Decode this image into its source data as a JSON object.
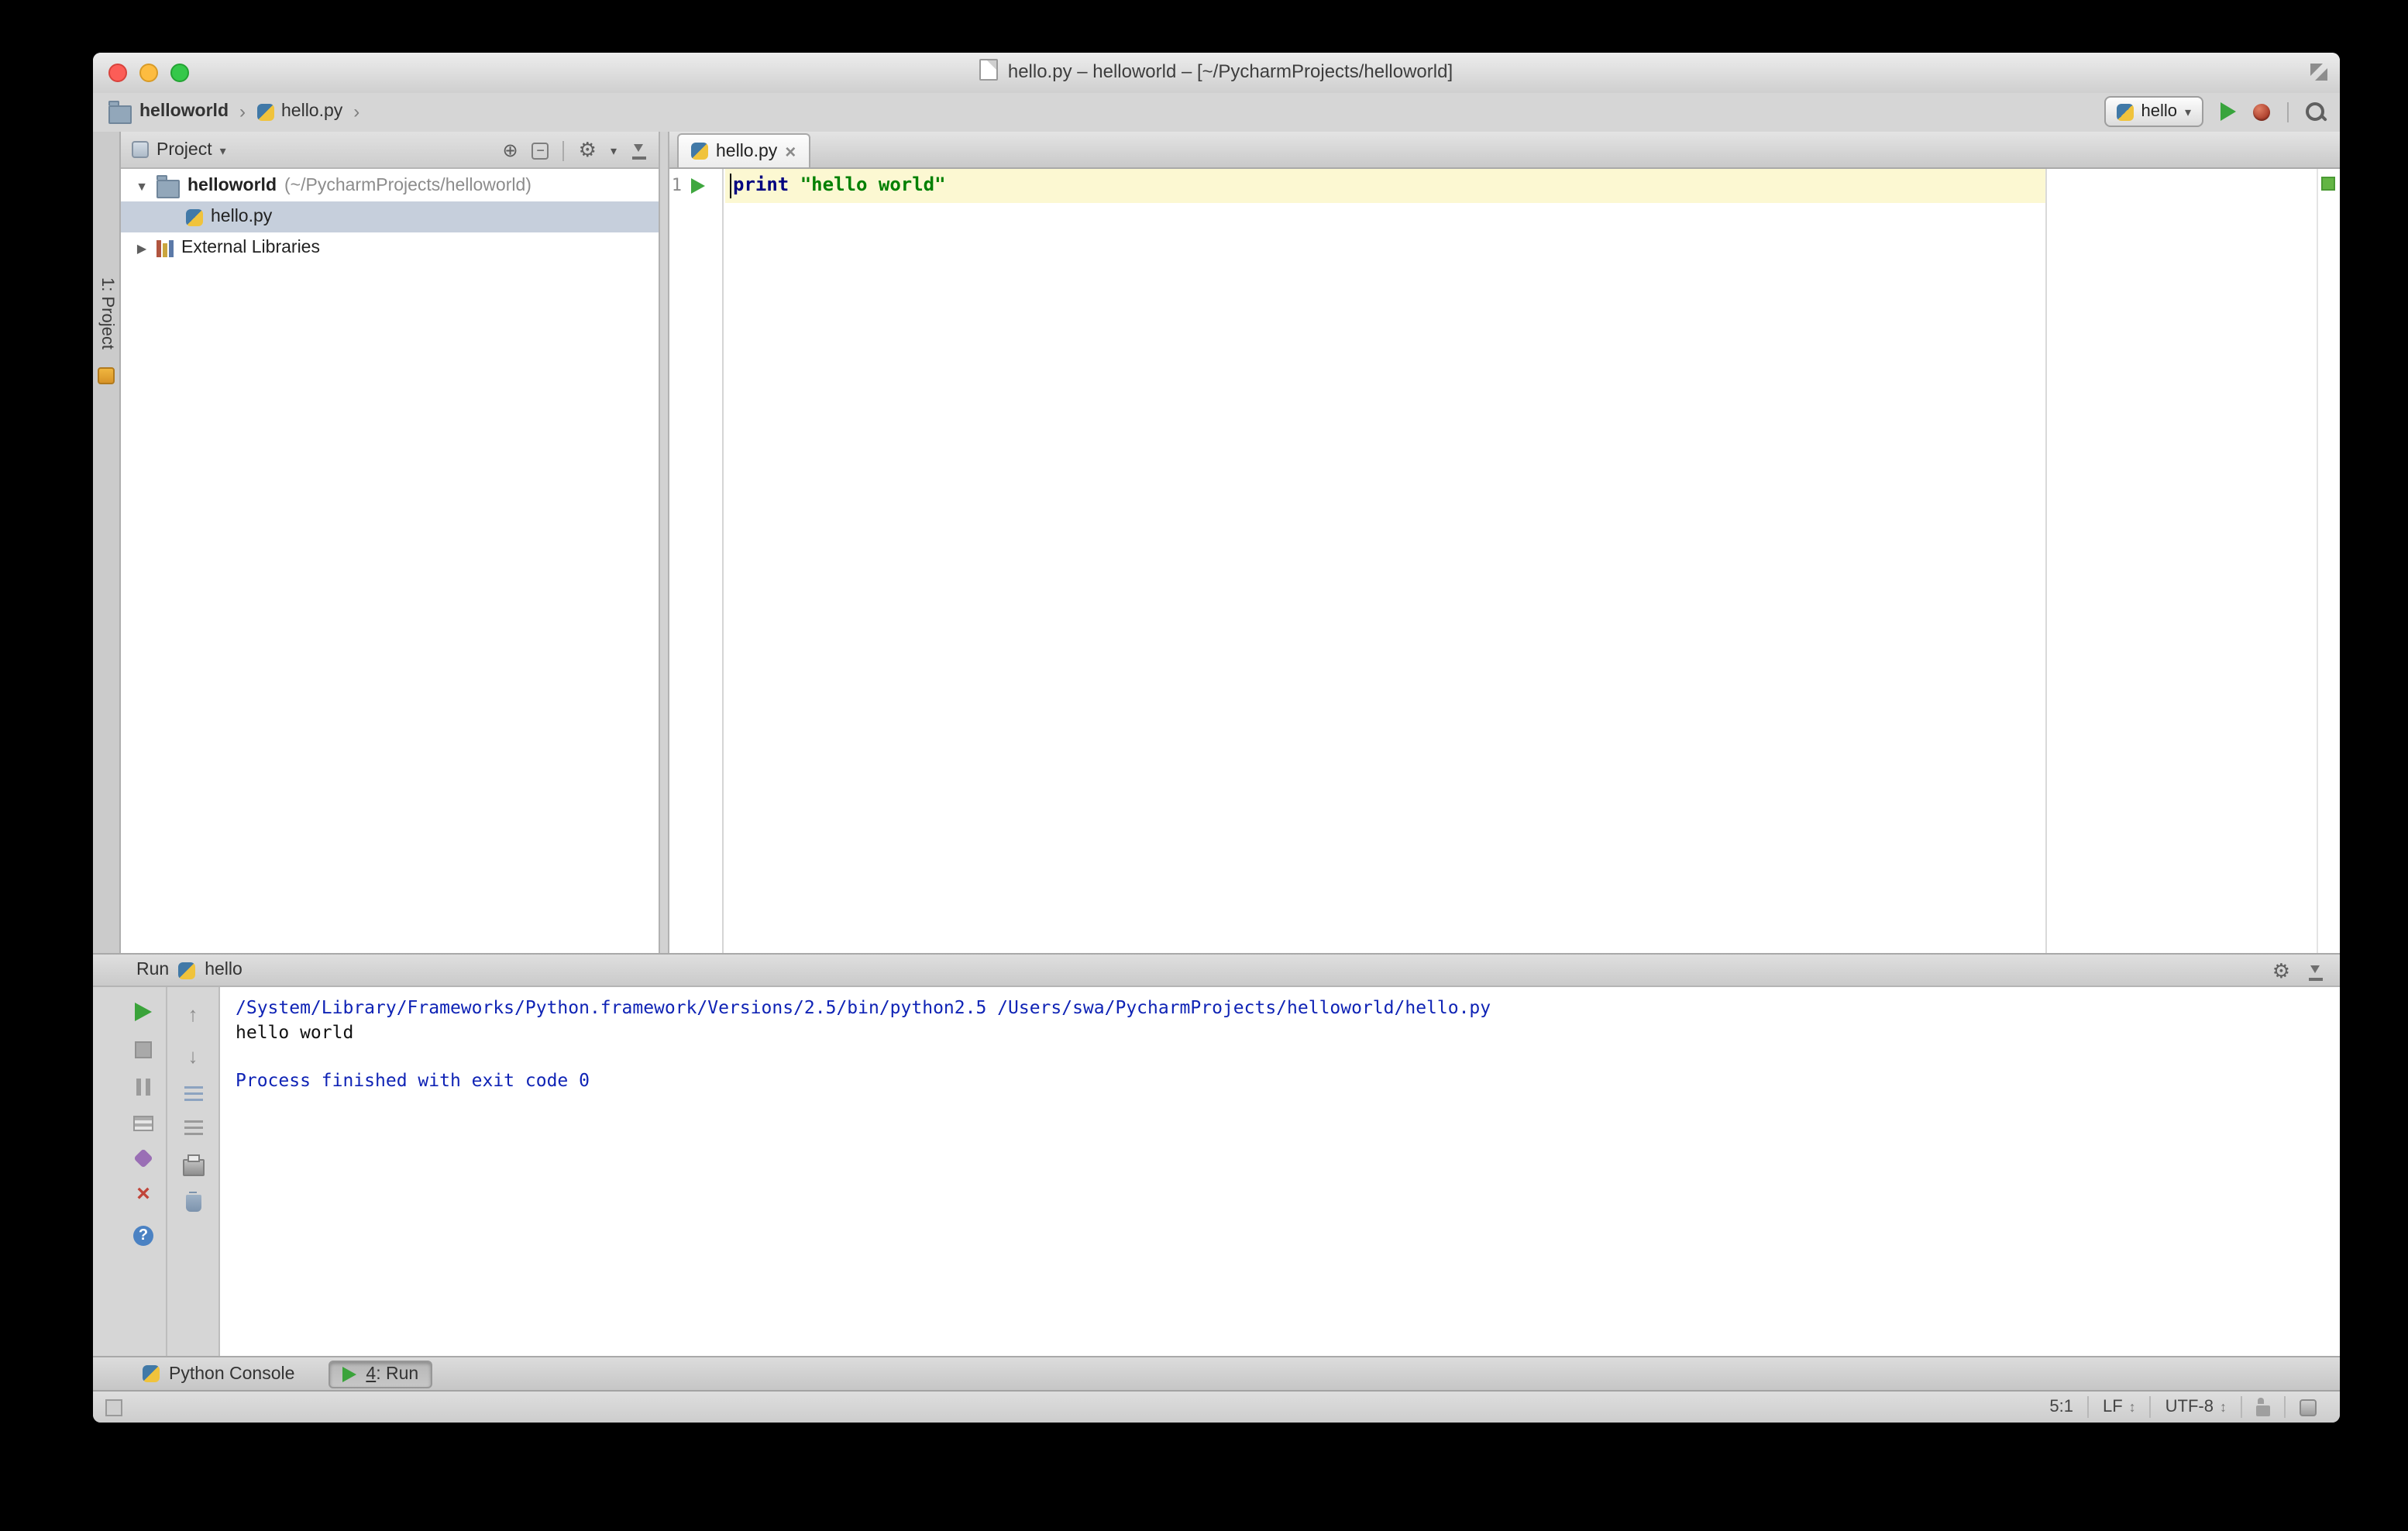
{
  "window": {
    "title": "hello.py – helloworld – [~/PycharmProjects/helloworld]"
  },
  "navbar": {
    "crumb_project": "helloworld",
    "crumb_file": "hello.py",
    "run_config": "hello"
  },
  "project": {
    "stripe_label": "1: Project",
    "header_title": "Project",
    "root_name": "helloworld",
    "root_path": "(~/PycharmProjects/helloworld)",
    "file_name": "hello.py",
    "libraries_label": "External Libraries"
  },
  "editor": {
    "tab_label": "hello.py",
    "line_number": "1",
    "keyword": "print",
    "string_literal": "\"hello world\""
  },
  "run": {
    "panel_title": "Run",
    "config_name": "hello",
    "console_lines": [
      "/System/Library/Frameworks/Python.framework/Versions/2.5/bin/python2.5 /Users/swa/PycharmProjects/helloworld/hello.py",
      "hello world",
      "",
      "Process finished with exit code 0"
    ]
  },
  "toolwindows": {
    "python_console": "Python Console",
    "run_number": "4",
    "run_suffix": ": Run"
  },
  "status": {
    "caret_position": "5:1",
    "line_ending": "LF",
    "encoding": "UTF-8"
  },
  "colors": {
    "keyword": "#000080",
    "string": "#008000",
    "console_info": "#0f23b5",
    "run_green": "#3aa33a",
    "current_line": "#fcf8d2",
    "selection": "#c6cfdc"
  }
}
